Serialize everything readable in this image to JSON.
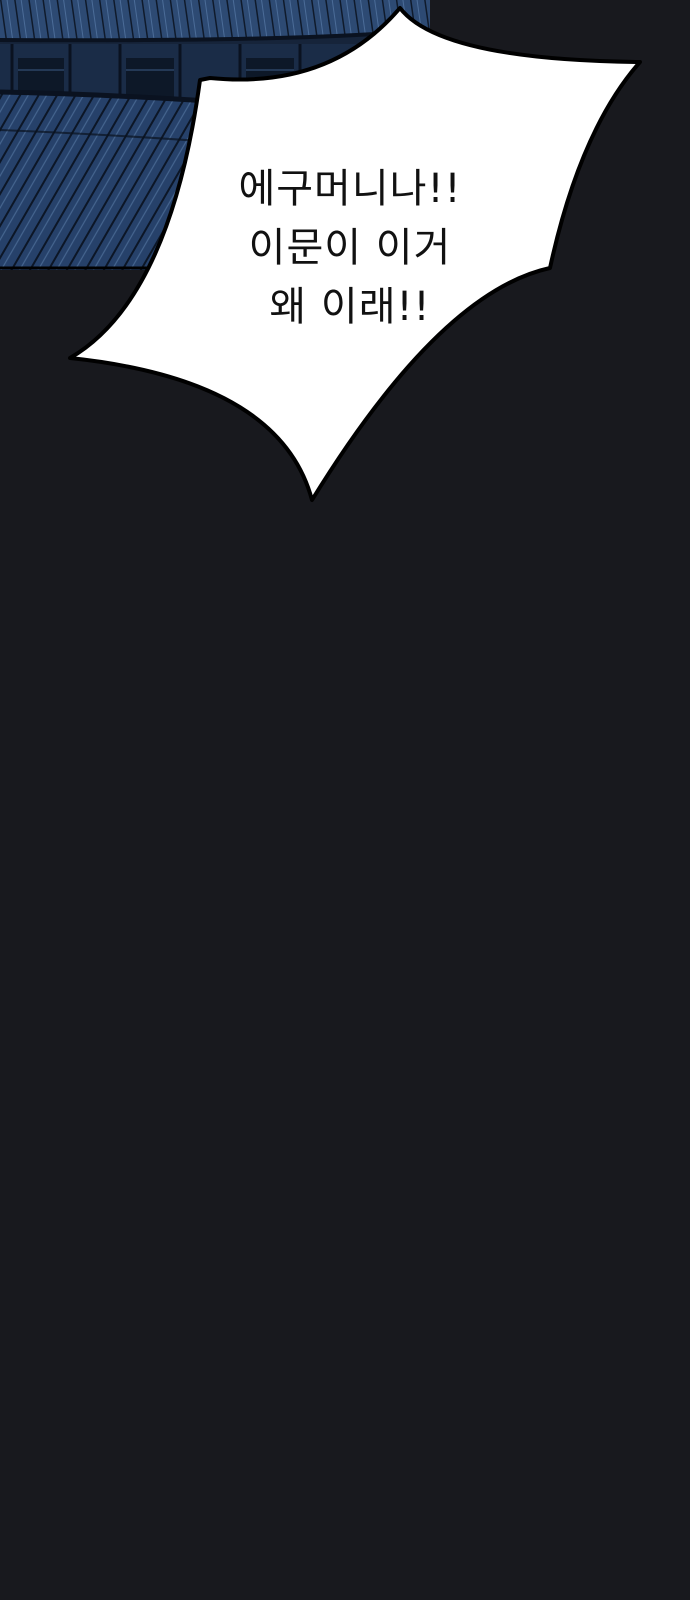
{
  "panel": {
    "background_color": "#18191e",
    "scene": "night-palace-rooftop",
    "scene_color": "#2c4a72"
  },
  "speech_bubble": {
    "lines": [
      "에구머니나!!",
      "이문이 이거",
      "왜 이래!!"
    ],
    "fill": "#ffffff",
    "stroke": "#000000"
  }
}
